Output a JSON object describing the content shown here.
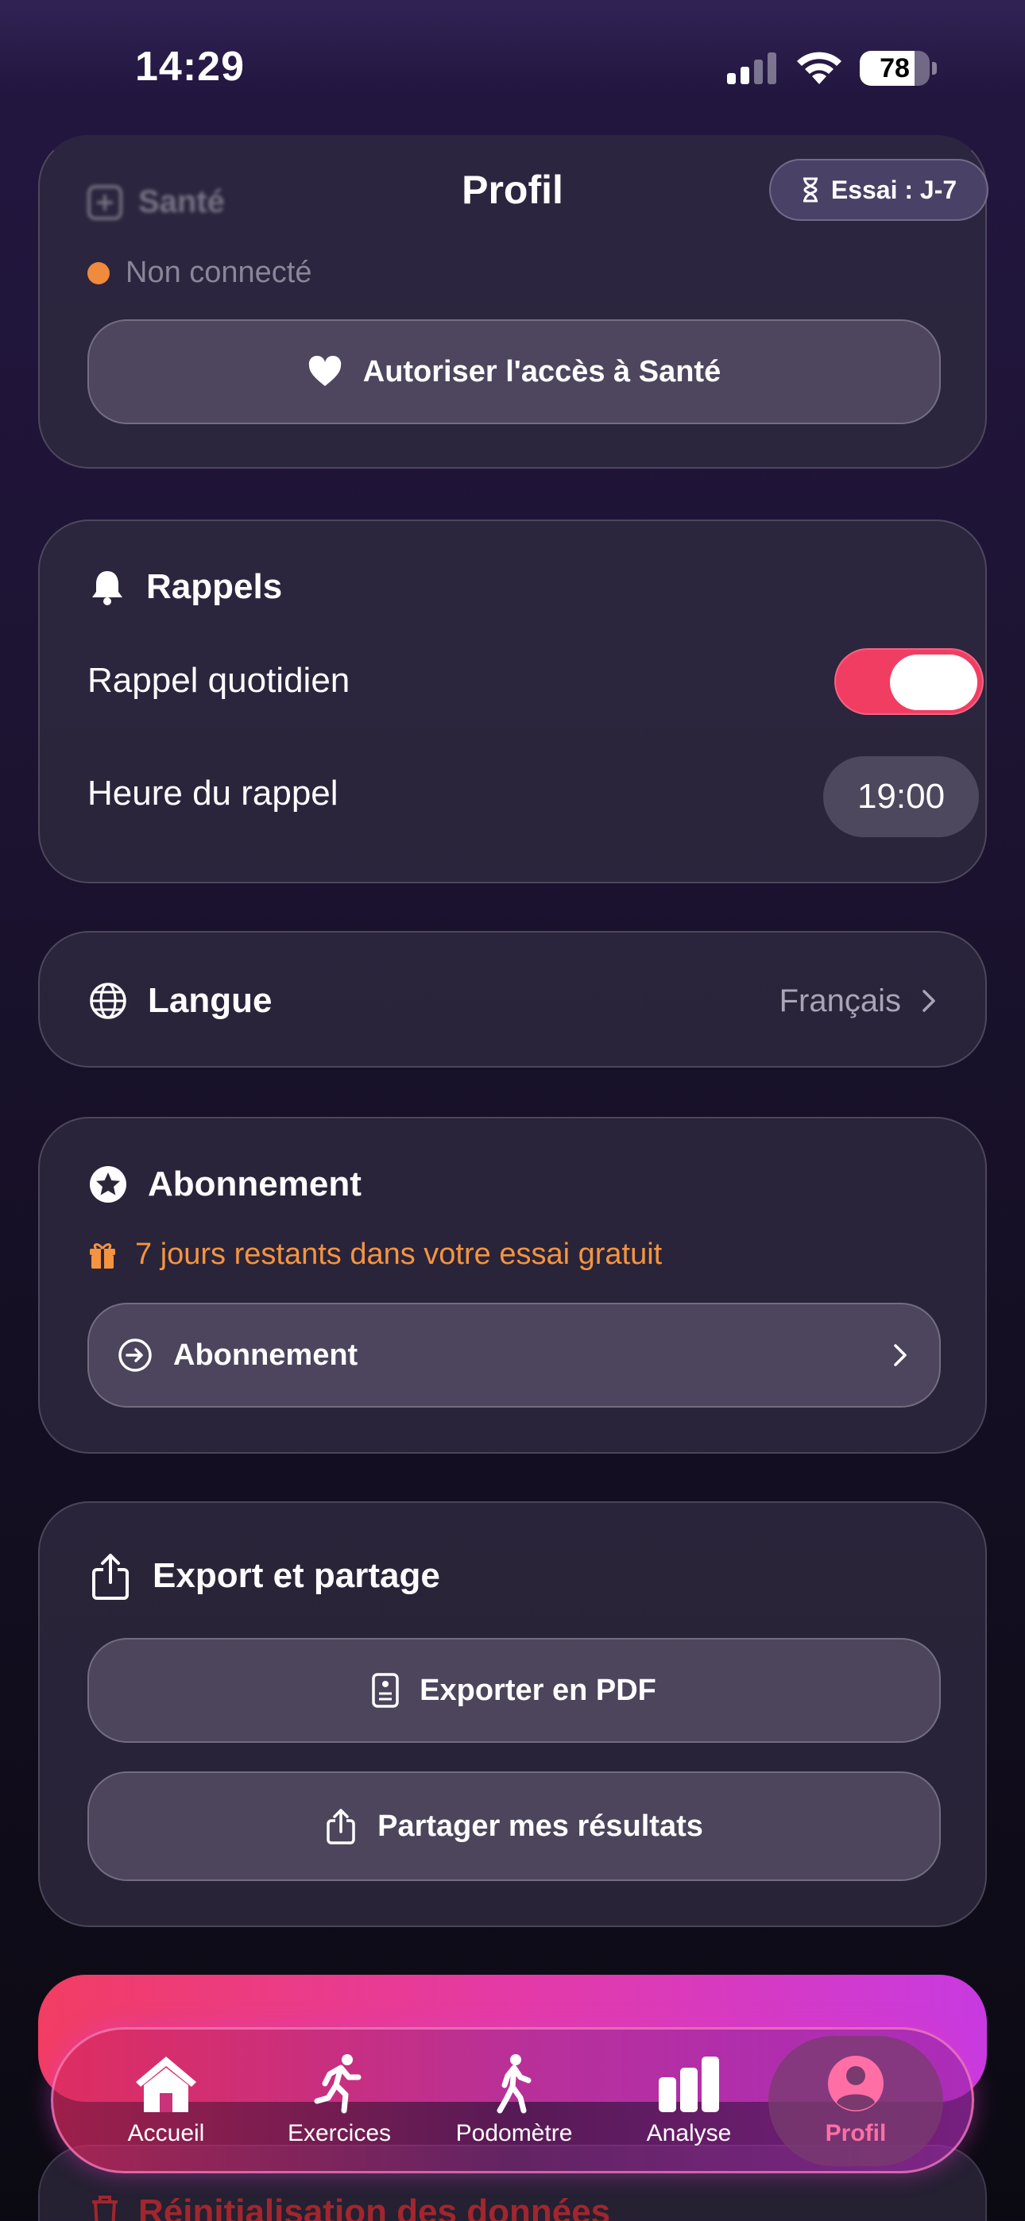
{
  "status_bar": {
    "time": "14:29",
    "battery": "78",
    "battery_level": 0.78
  },
  "header": {
    "title": "Profil",
    "trial_badge": "Essai : J-7"
  },
  "health": {
    "title": "Santé",
    "status": "Non connecté",
    "authorize_button": "Autoriser l'accès à Santé"
  },
  "reminders": {
    "title": "Rappels",
    "daily_label": "Rappel quotidien",
    "daily_enabled": true,
    "time_label": "Heure du rappel",
    "time_value": "19:00"
  },
  "language": {
    "title": "Langue",
    "value": "Français"
  },
  "subscription": {
    "title": "Abonnement",
    "trial_text": "7 jours restants dans votre essai gratuit",
    "button": "Abonnement"
  },
  "export": {
    "title": "Export et partage",
    "pdf_button": "Exporter en PDF",
    "share_button": "Partager mes résultats"
  },
  "reset": {
    "title": "Réinitialisation des données"
  },
  "tabs": [
    {
      "label": "Accueil",
      "icon": "house-icon",
      "active": false
    },
    {
      "label": "Exercices",
      "icon": "running-icon",
      "active": false
    },
    {
      "label": "Podomètre",
      "icon": "walking-icon",
      "active": false
    },
    {
      "label": "Analyse",
      "icon": "bar-chart-icon",
      "active": false
    },
    {
      "label": "Profil",
      "icon": "person-circle-icon",
      "active": true
    }
  ],
  "colors": {
    "accent": "#f23d63",
    "trial_orange": "#f49440",
    "active_tab": "#ff6fa6"
  }
}
